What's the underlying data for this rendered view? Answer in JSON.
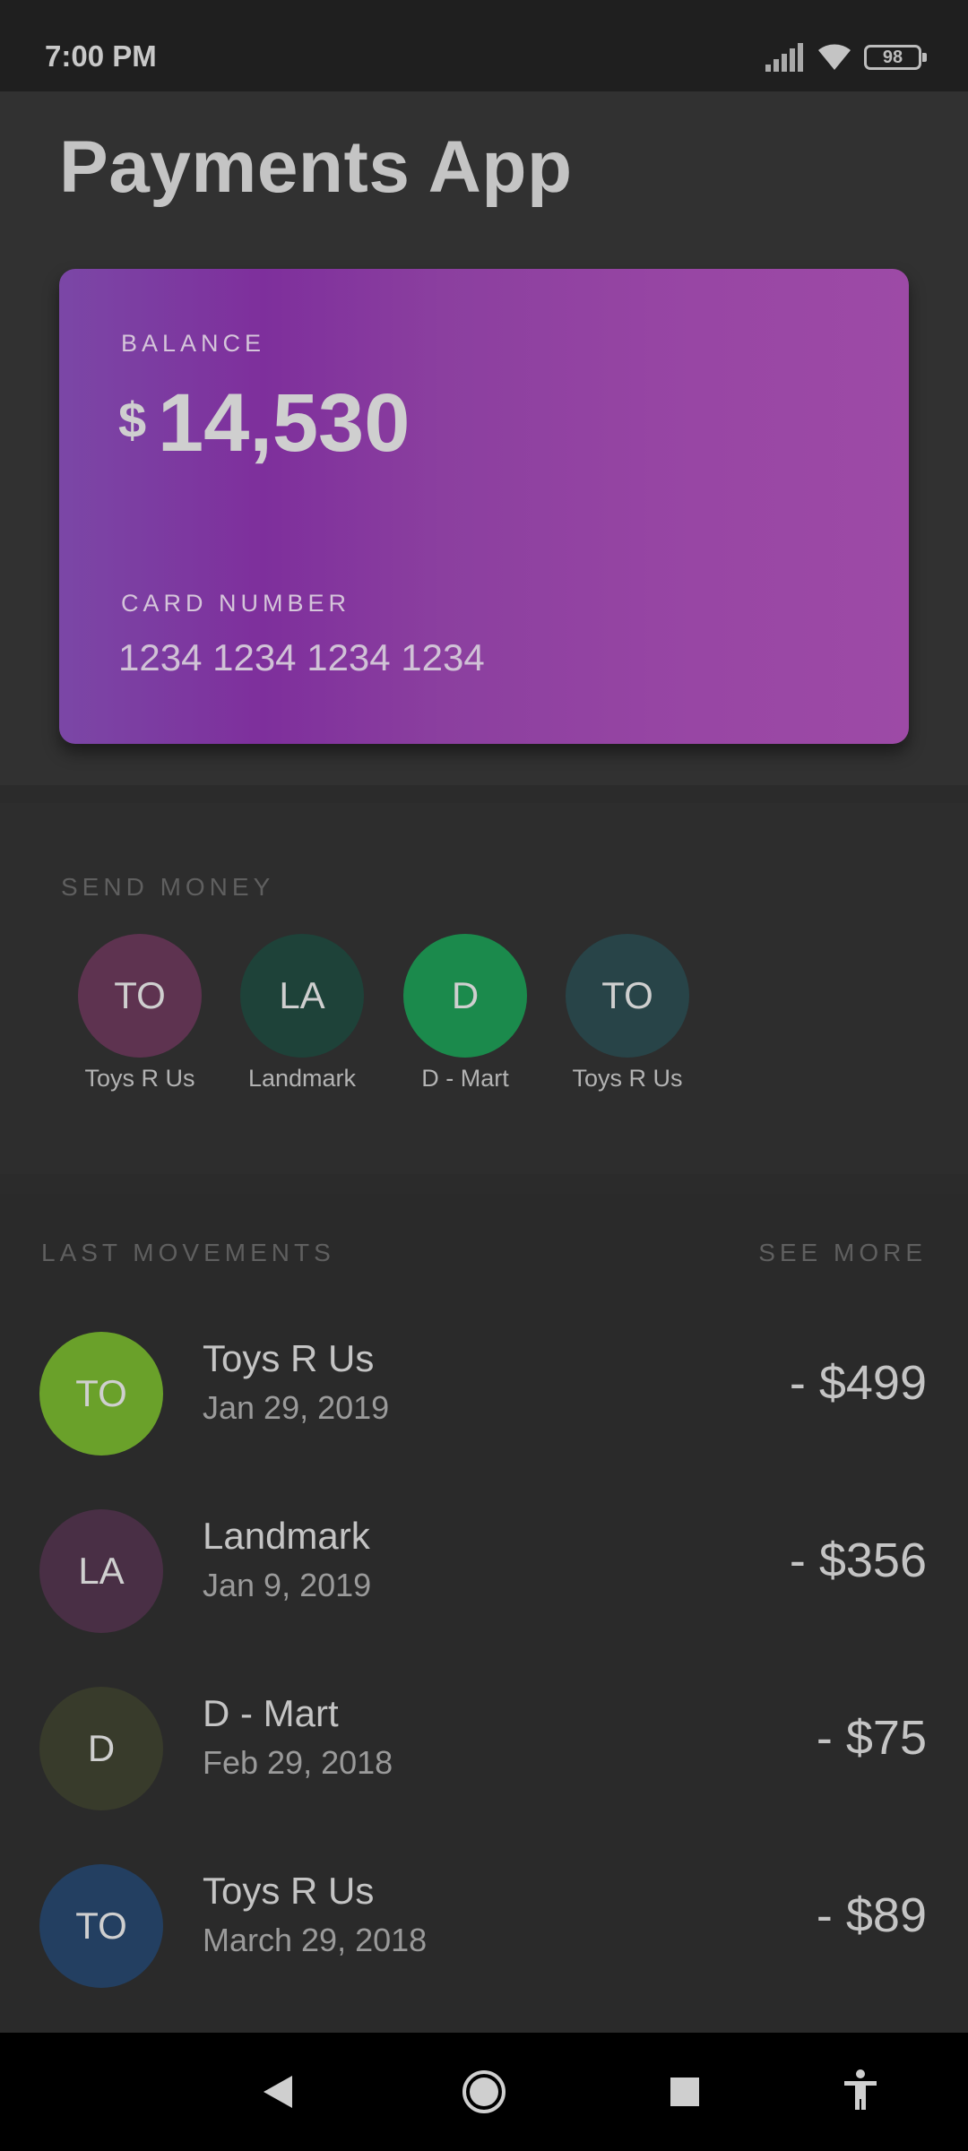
{
  "status_bar": {
    "time": "7:00 PM",
    "battery": "98",
    "icons": [
      "signal-icon",
      "wifi-icon",
      "battery-icon"
    ]
  },
  "header": {
    "title": "Payments App"
  },
  "card": {
    "balance_label": "BALANCE",
    "currency": "$",
    "balance": "14,530",
    "card_number_label": "CARD NUMBER",
    "card_number": "1234 1234 1234 1234"
  },
  "send_money": {
    "label": "SEND MONEY",
    "contacts": [
      {
        "initials": "TO",
        "name": "Toys R Us",
        "color": "#5e3350"
      },
      {
        "initials": "LA",
        "name": "Landmark",
        "color": "#1e4239"
      },
      {
        "initials": "D",
        "name": "D - Mart",
        "color": "#1b8a4c"
      },
      {
        "initials": "TO",
        "name": "Toys R Us",
        "color": "#284448"
      }
    ]
  },
  "movements": {
    "label": "LAST MOVEMENTS",
    "see_more": "SEE MORE",
    "items": [
      {
        "initials": "TO",
        "name": "Toys R Us",
        "date": "Jan 29, 2019",
        "amount": "- $499",
        "color": "#6aa12a"
      },
      {
        "initials": "LA",
        "name": "Landmark",
        "date": "Jan 9, 2019",
        "amount": "- $356",
        "color": "#492f45"
      },
      {
        "initials": "D",
        "name": "D - Mart",
        "date": "Feb 29, 2018",
        "amount": "- $75",
        "color": "#383b2b"
      },
      {
        "initials": "TO",
        "name": "Toys R Us",
        "date": "March 29, 2018",
        "amount": "- $89",
        "color": "#233f61"
      }
    ]
  },
  "nav_bar": {
    "buttons": [
      "back-icon",
      "home-icon",
      "recents-icon",
      "accessibility-icon"
    ]
  }
}
